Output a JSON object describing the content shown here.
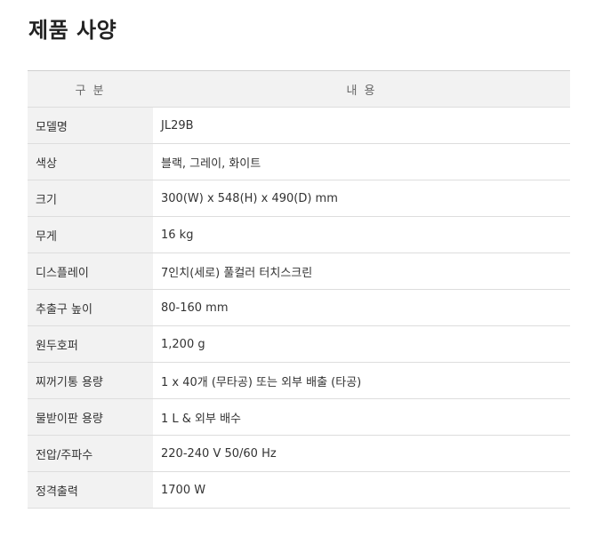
{
  "title": "제품 사양",
  "table": {
    "headers": {
      "category": "구 분",
      "content": "내 용"
    },
    "rows": [
      {
        "label": "모델명",
        "value": "JL29B"
      },
      {
        "label": "색상",
        "value": "블랙, 그레이, 화이트"
      },
      {
        "label": "크기",
        "value": "300(W) x 548(H) x 490(D) mm"
      },
      {
        "label": "무게",
        "value": "16 kg"
      },
      {
        "label": "디스플레이",
        "value": "7인치(세로) 풀컬러 터치스크린"
      },
      {
        "label": "추출구 높이",
        "value": "80-160 mm"
      },
      {
        "label": "원두호퍼",
        "value": "1,200 g"
      },
      {
        "label": "찌꺼기통 용량",
        "value": "1 x 40개 (무타공) 또는 외부 배출 (타공)"
      },
      {
        "label": "물받이판 용량",
        "value": "1 L & 외부 배수"
      },
      {
        "label": "전압/주파수",
        "value": "220-240 V 50/60 Hz"
      },
      {
        "label": "정격출력",
        "value": "1700 W"
      }
    ]
  }
}
